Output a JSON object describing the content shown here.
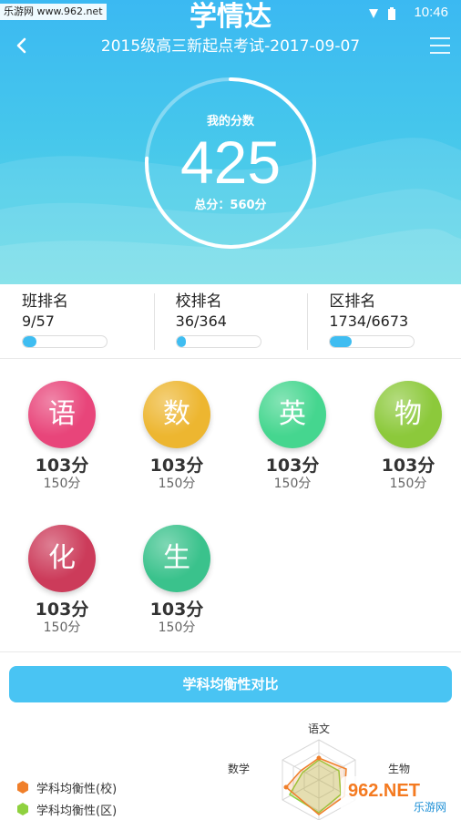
{
  "status_bar": {
    "watermark": "乐游网 www.962.net",
    "time": "10:46"
  },
  "header": {
    "app_title": "学情达",
    "exam_title": "2015级高三新起点考试-2017-09-07",
    "score_label": "我的分数",
    "score": "425",
    "total_label": "总分：560分",
    "score_fraction": 0.759
  },
  "ranks": [
    {
      "label": "班排名",
      "value": "9/57",
      "fraction": 0.158
    },
    {
      "label": "校排名",
      "value": "36/364",
      "fraction": 0.099
    },
    {
      "label": "区排名",
      "value": "1734/6673",
      "fraction": 0.26
    }
  ],
  "subjects": [
    {
      "char": "语",
      "score": "103分",
      "full": "150分",
      "color": "#e8457a"
    },
    {
      "char": "数",
      "score": "103分",
      "full": "150分",
      "color": "#edb630"
    },
    {
      "char": "英",
      "score": "103分",
      "full": "150分",
      "color": "#45d68f"
    },
    {
      "char": "物",
      "score": "103分",
      "full": "150分",
      "color": "#8cc93b"
    },
    {
      "char": "化",
      "score": "103分",
      "full": "150分",
      "color": "#cc3b5a"
    },
    {
      "char": "生",
      "score": "103分",
      "full": "150分",
      "color": "#3ac28c"
    }
  ],
  "balance": {
    "button_label": "学科均衡性对比",
    "axis_labels": {
      "top": "语文",
      "left": "数学",
      "right": "生物"
    },
    "legend": [
      {
        "label": "学科均衡性(校)",
        "color": "#f07f2a"
      },
      {
        "label": "学科均衡性(区)",
        "color": "#8fd13f"
      }
    ]
  },
  "watermark_bottom": {
    "line1": "962.NET",
    "line2": "乐游网"
  }
}
